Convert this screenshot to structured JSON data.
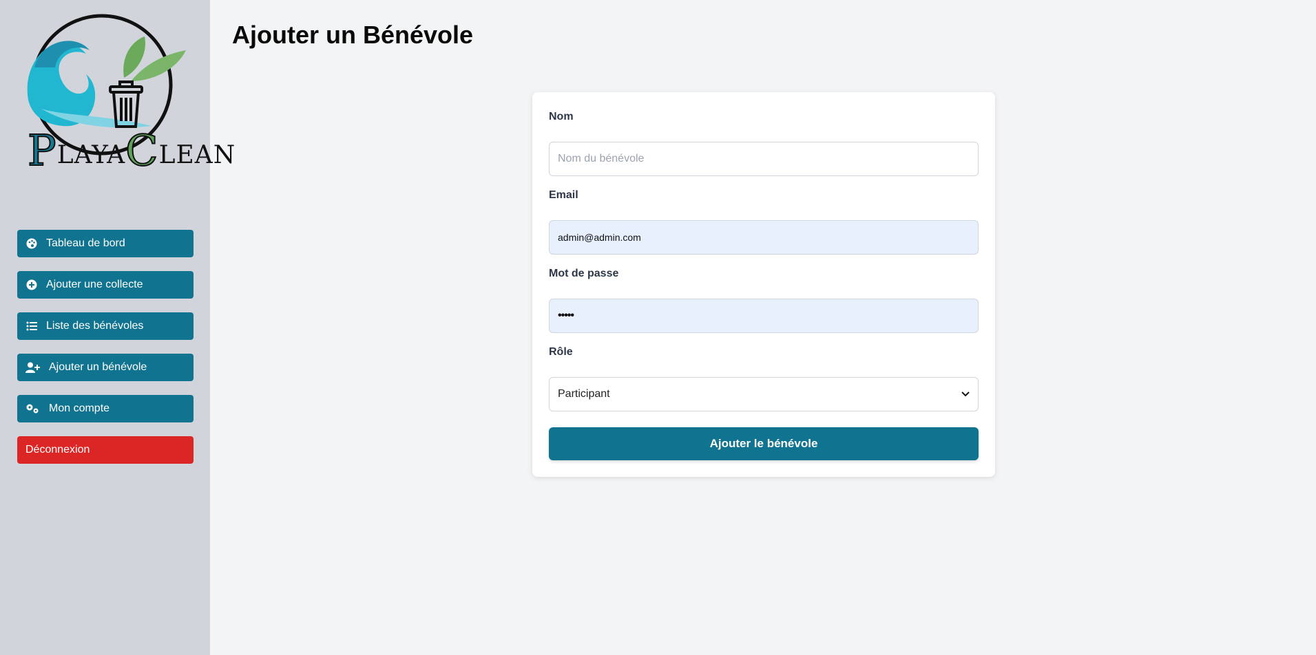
{
  "logo": {
    "brand_text": "PlayaClean",
    "letters": {
      "p": "P",
      "laya": "LAYA",
      "c": "C",
      "lean": "LEAN"
    }
  },
  "sidebar": {
    "items": [
      {
        "label": "Tableau de bord",
        "icon": "palette-icon"
      },
      {
        "label": "Ajouter une collecte",
        "icon": "plus-circle-icon"
      },
      {
        "label": "Liste des bénévoles",
        "icon": "list-icon"
      },
      {
        "label": "Ajouter un bénévole",
        "icon": "user-plus-icon"
      },
      {
        "label": "Mon compte",
        "icon": "cogs-icon"
      },
      {
        "label": "Déconnexion",
        "icon": ""
      }
    ]
  },
  "page": {
    "title": "Ajouter un Bénévole"
  },
  "form": {
    "name": {
      "label": "Nom",
      "placeholder": "Nom du bénévole",
      "value": ""
    },
    "email": {
      "label": "Email",
      "value": "admin@admin.com"
    },
    "password": {
      "label": "Mot de passe",
      "value": "•••••"
    },
    "role": {
      "label": "Rôle",
      "selected": "Participant"
    },
    "submit_label": "Ajouter le bénévole"
  },
  "colors": {
    "primary": "#107491",
    "danger": "#dc2626",
    "sidebar_bg": "#d1d5db",
    "page_bg": "#f3f4f6"
  }
}
